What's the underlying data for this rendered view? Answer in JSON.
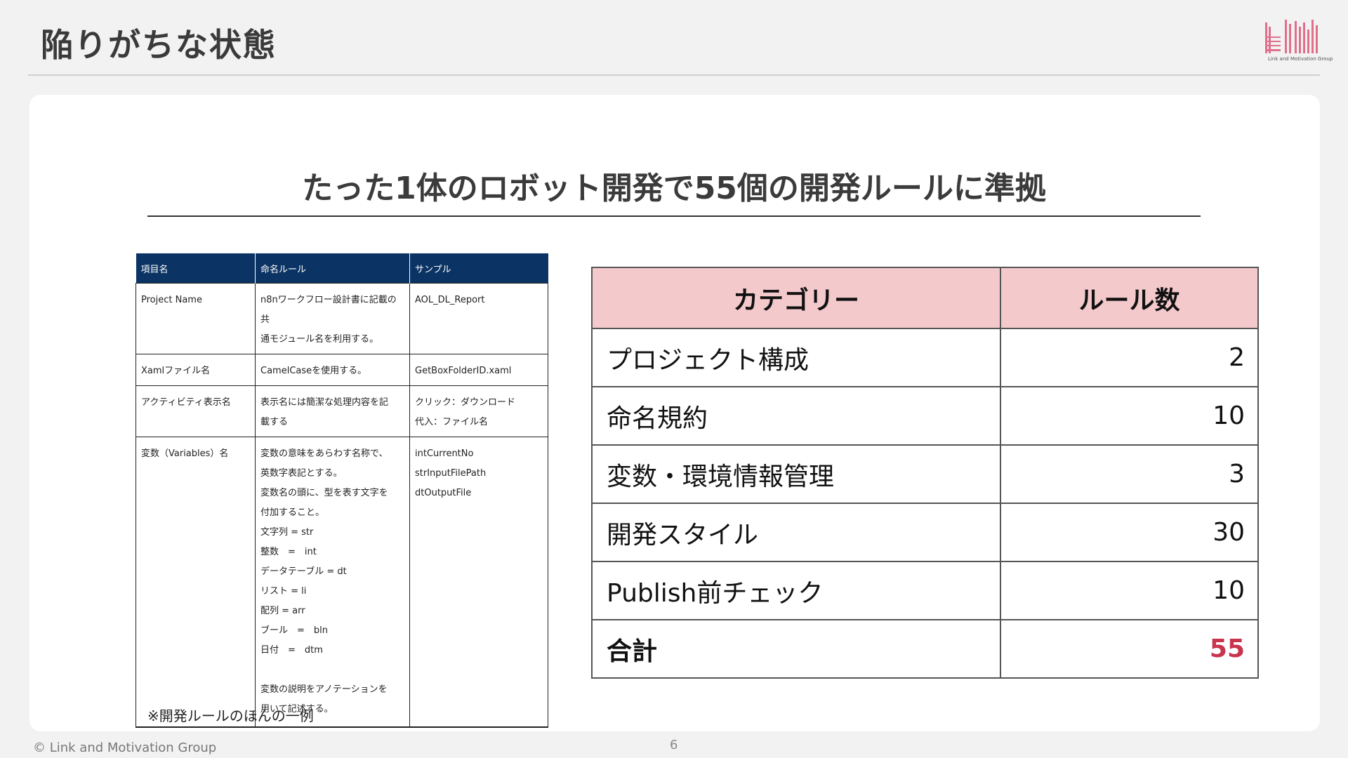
{
  "header": {
    "title": "陥りがちな状態",
    "logo_caption": "Link and Motivation Group"
  },
  "headline": "たった1体のロボット開発で55個の開発ルールに準拠",
  "rules_table": {
    "headers": [
      "項目名",
      "命名ルール",
      "サンプル"
    ],
    "rows": [
      [
        "Project Name",
        "n8nワークフロー設計書に記載の共\n通モジュール名を利用する。",
        "AOL_DL_Report"
      ],
      [
        "Xamlファイル名",
        "CamelCaseを使用する。",
        "GetBoxFolderID.xaml"
      ],
      [
        "アクティビティ表示名",
        "表示名には簡潔な処理内容を記\n載する",
        "クリック：ダウンロード\n代入：ファイル名"
      ],
      [
        "変数（Variables）名",
        "変数の意味をあらわす名称で、\n英数字表記とする。\n変数名の頭に、型を表す文字を\n付加すること。\n文字列 = str\n整数　=　int\nデータテーブル = dt\nリスト = li\n配列 = arr\nブール　=　bln\n日付　=　dtm\n\n変数の説明をアノテーションを\n用いて記述する。",
        "intCurrentNo\nstrInputFilePath\ndtOutputFile"
      ]
    ],
    "note": "※開発ルールのほんの一例"
  },
  "category_table": {
    "headers": [
      "カテゴリー",
      "ルール数"
    ],
    "rows": [
      [
        "プロジェクト構成",
        "2"
      ],
      [
        "命名規約",
        "10"
      ],
      [
        "変数・環境情報管理",
        "3"
      ],
      [
        "開発スタイル",
        "30"
      ],
      [
        "Publish前チェック",
        "10"
      ]
    ],
    "total": [
      "合計",
      "55"
    ]
  },
  "footer": {
    "copyright": "© Link and Motivation Group",
    "page_number": "6"
  },
  "colors": {
    "table_header_navy": "#0b3364",
    "category_header_pink": "#f4c9cc",
    "total_red": "#c8334e",
    "logo_pink": "#e0708a"
  }
}
